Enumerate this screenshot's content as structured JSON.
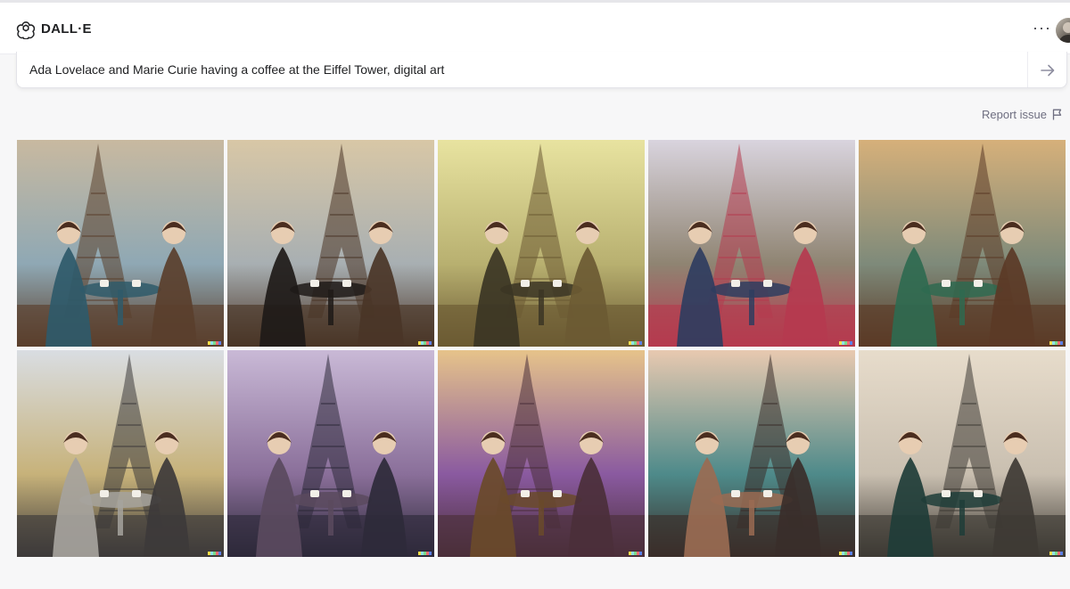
{
  "app": {
    "name": "DALL·E",
    "logo_icon": "openai-logo-icon",
    "more_icon": "more-horizontal-icon",
    "more_glyph": "···",
    "avatar_icon": "user-avatar"
  },
  "prompt": {
    "text": "Ada Lovelace and Marie Curie having a coffee at the Eiffel Tower, digital art",
    "submit_icon": "arrow-right-icon"
  },
  "report": {
    "label": "Report issue",
    "icon": "flag-icon"
  },
  "images": [
    {
      "id": 1,
      "name": "generated-image-1",
      "palette": [
        "#c8b9a0",
        "#5a3f2c",
        "#8fa8b4",
        "#2f5a6a"
      ]
    },
    {
      "id": 2,
      "name": "generated-image-2",
      "palette": [
        "#d8c7a6",
        "#4a3527",
        "#a8afb2",
        "#1e1a18"
      ]
    },
    {
      "id": 3,
      "name": "generated-image-3",
      "palette": [
        "#e8e3a0",
        "#6b5a33",
        "#b8b070",
        "#3b3524"
      ]
    },
    {
      "id": 4,
      "name": "generated-image-4",
      "palette": [
        "#d9d4de",
        "#b53a4f",
        "#8f8472",
        "#2f3d5f"
      ]
    },
    {
      "id": 5,
      "name": "generated-image-5",
      "palette": [
        "#d6b07a",
        "#5b3a26",
        "#7e8a7a",
        "#2f6a50"
      ]
    },
    {
      "id": 6,
      "name": "generated-image-6",
      "palette": [
        "#d9dde2",
        "#3d3a3a",
        "#c7b27a",
        "#a6a39d"
      ]
    },
    {
      "id": 7,
      "name": "generated-image-7",
      "palette": [
        "#c9b9d6",
        "#2e2a3a",
        "#8a6f9a",
        "#5a4a5e"
      ]
    },
    {
      "id": 8,
      "name": "generated-image-8",
      "palette": [
        "#e6c38a",
        "#4b2f3a",
        "#8a5aa0",
        "#6a4a2a"
      ]
    },
    {
      "id": 9,
      "name": "generated-image-9",
      "palette": [
        "#e8c9b0",
        "#3a2e2a",
        "#4e8a8a",
        "#9a6b52"
      ]
    },
    {
      "id": 10,
      "name": "generated-image-10",
      "palette": [
        "#e7dccb",
        "#3e3a34",
        "#c9bfb0",
        "#1f3d38"
      ]
    }
  ],
  "watermark_colors": [
    "#f7e04b",
    "#8ee0e9",
    "#7bdc8a",
    "#ef6b73",
    "#5b7fe6"
  ]
}
